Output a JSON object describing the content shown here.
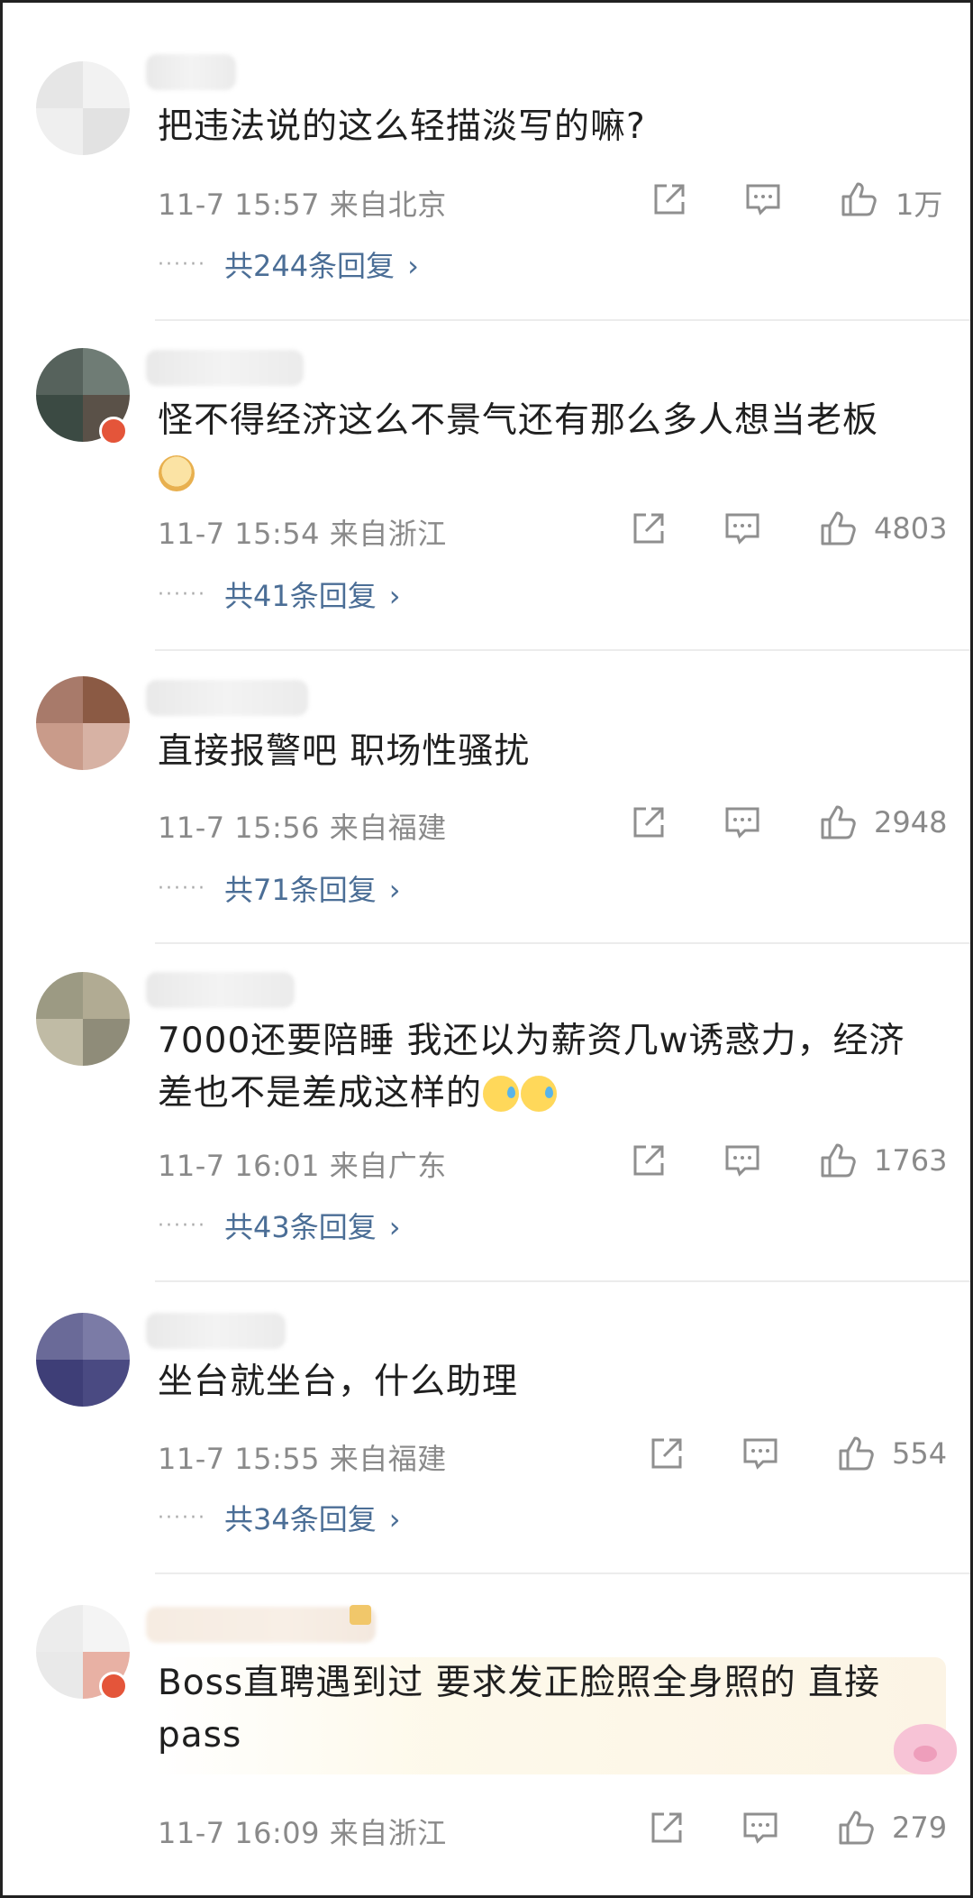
{
  "comments": [
    {
      "text": "把违法说的这么轻描淡写的嘛?",
      "time": "11-7 15:57",
      "location": "来自北京",
      "likes": "1万",
      "replies": "共244条回复",
      "avatar_colors": [
        "#e6e6e6",
        "#f2f2f2",
        "#efefef",
        "#e2e2e2"
      ]
    },
    {
      "text": "怪不得经济这么不景气还有那么多人想当老板",
      "emoji": [
        "doge-emoji"
      ],
      "time": "11-7 15:54",
      "location": "来自浙江",
      "likes": "4803",
      "replies": "共41条回复",
      "avatar_colors": [
        "#56625c",
        "#6f7c75",
        "#3b4a43",
        "#5a5148"
      ]
    },
    {
      "text": "直接报警吧 职场性骚扰",
      "time": "11-7 15:56",
      "location": "来自福建",
      "likes": "2948",
      "replies": "共71条回复",
      "avatar_colors": [
        "#a87a6a",
        "#8b5a44",
        "#c99b8a",
        "#d7b2a4"
      ]
    },
    {
      "text": "7000还要陪睡 我还以为薪资几w诱惑力，经济差也不是差成这样的",
      "emoji": [
        "sweat-emoji",
        "sweat-emoji"
      ],
      "time": "11-7 16:01",
      "location": "来自广东",
      "likes": "1763",
      "replies": "共43条回复",
      "avatar_colors": [
        "#9c9a83",
        "#b1ab93",
        "#c0bba5",
        "#8f8c79"
      ]
    },
    {
      "text": "坐台就坐台，什么助理",
      "time": "11-7 15:55",
      "location": "来自福建",
      "likes": "554",
      "replies": "共34条回复",
      "avatar_colors": [
        "#6a6a98",
        "#7b7ba6",
        "#3e3e77",
        "#4a4a82"
      ]
    },
    {
      "text": "Boss直聘遇到过 要求发正脸照全身照的 直接pass",
      "time": "11-7 16:09",
      "location": "来自浙江",
      "likes": "279",
      "avatar_colors": [
        "#ececec",
        "#f4f4f4",
        "#e9e9e9",
        "#e8b1a4"
      ]
    }
  ],
  "colors": {
    "reply_link": "#4b6e96",
    "meta_text": "#8a8a8a",
    "body_text": "#1f1f1f"
  }
}
